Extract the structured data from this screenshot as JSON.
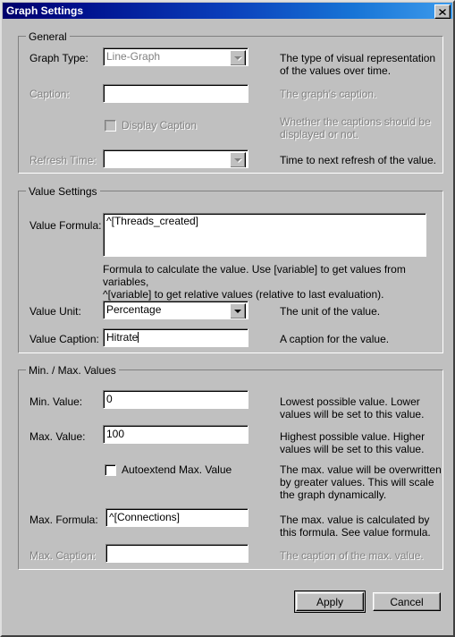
{
  "window": {
    "title": "Graph Settings",
    "close_icon": "close-icon",
    "close_glyph": "✕"
  },
  "general": {
    "legend": "General",
    "graph_type": {
      "label": "Graph Type:",
      "value": "Line-Graph",
      "description": "The type of visual representation\nof the values over time.",
      "enabled": false
    },
    "caption": {
      "label": "Caption:",
      "value": "",
      "description": "The graph's caption.",
      "enabled": false
    },
    "display_caption": {
      "label": "Display Caption",
      "checked": false,
      "description": "Whether the captions should be\ndisplayed or not.",
      "enabled": false
    },
    "refresh_time": {
      "label": "Refresh Time:",
      "value": "",
      "description": "Time to next refresh of the value.",
      "enabled": false
    }
  },
  "value_settings": {
    "legend": "Value Settings",
    "value_formula": {
      "label": "Value Formula:",
      "value": "^[Threads_created]",
      "hint": "Formula to calculate the value. Use [variable] to get values from variables,\n^[variable] to get relative values (relative to last evaluation)."
    },
    "value_unit": {
      "label": "Value Unit:",
      "value": "Percentage",
      "description": "The unit of the value."
    },
    "value_caption": {
      "label": "Value Caption:",
      "value": "Hitrate",
      "description": "A caption for the value.",
      "focused": true
    }
  },
  "min_max_values": {
    "legend": "Min. / Max. Values",
    "min_value": {
      "label": "Min. Value:",
      "value": "0",
      "description": "Lowest possible value. Lower\nvalues will be set to this value."
    },
    "max_value": {
      "label": "Max. Value:",
      "value": "100",
      "description": "Highest possible value. Higher\nvalues will be set to this value."
    },
    "autoextend": {
      "label": "Autoextend Max. Value",
      "checked": false,
      "description": "The max. value will be overwritten\nby greater values. This will scale\nthe graph dynamically."
    },
    "max_formula": {
      "label": "Max. Formula:",
      "value": "^[Connections]",
      "description": "The max. value is calculated by\nthis formula. See value formula."
    },
    "max_caption": {
      "label": "Max. Caption:",
      "value": "",
      "description": "The caption of the max. value.",
      "enabled": false
    }
  },
  "buttons": {
    "apply": "Apply",
    "cancel": "Cancel"
  },
  "colors": {
    "face": "#c0c0c0",
    "title_gradient_start": "#00006b",
    "title_gradient_end": "#3d9bec",
    "disabled_text": "#808080",
    "text": "#000000",
    "field_bg": "#ffffff"
  }
}
